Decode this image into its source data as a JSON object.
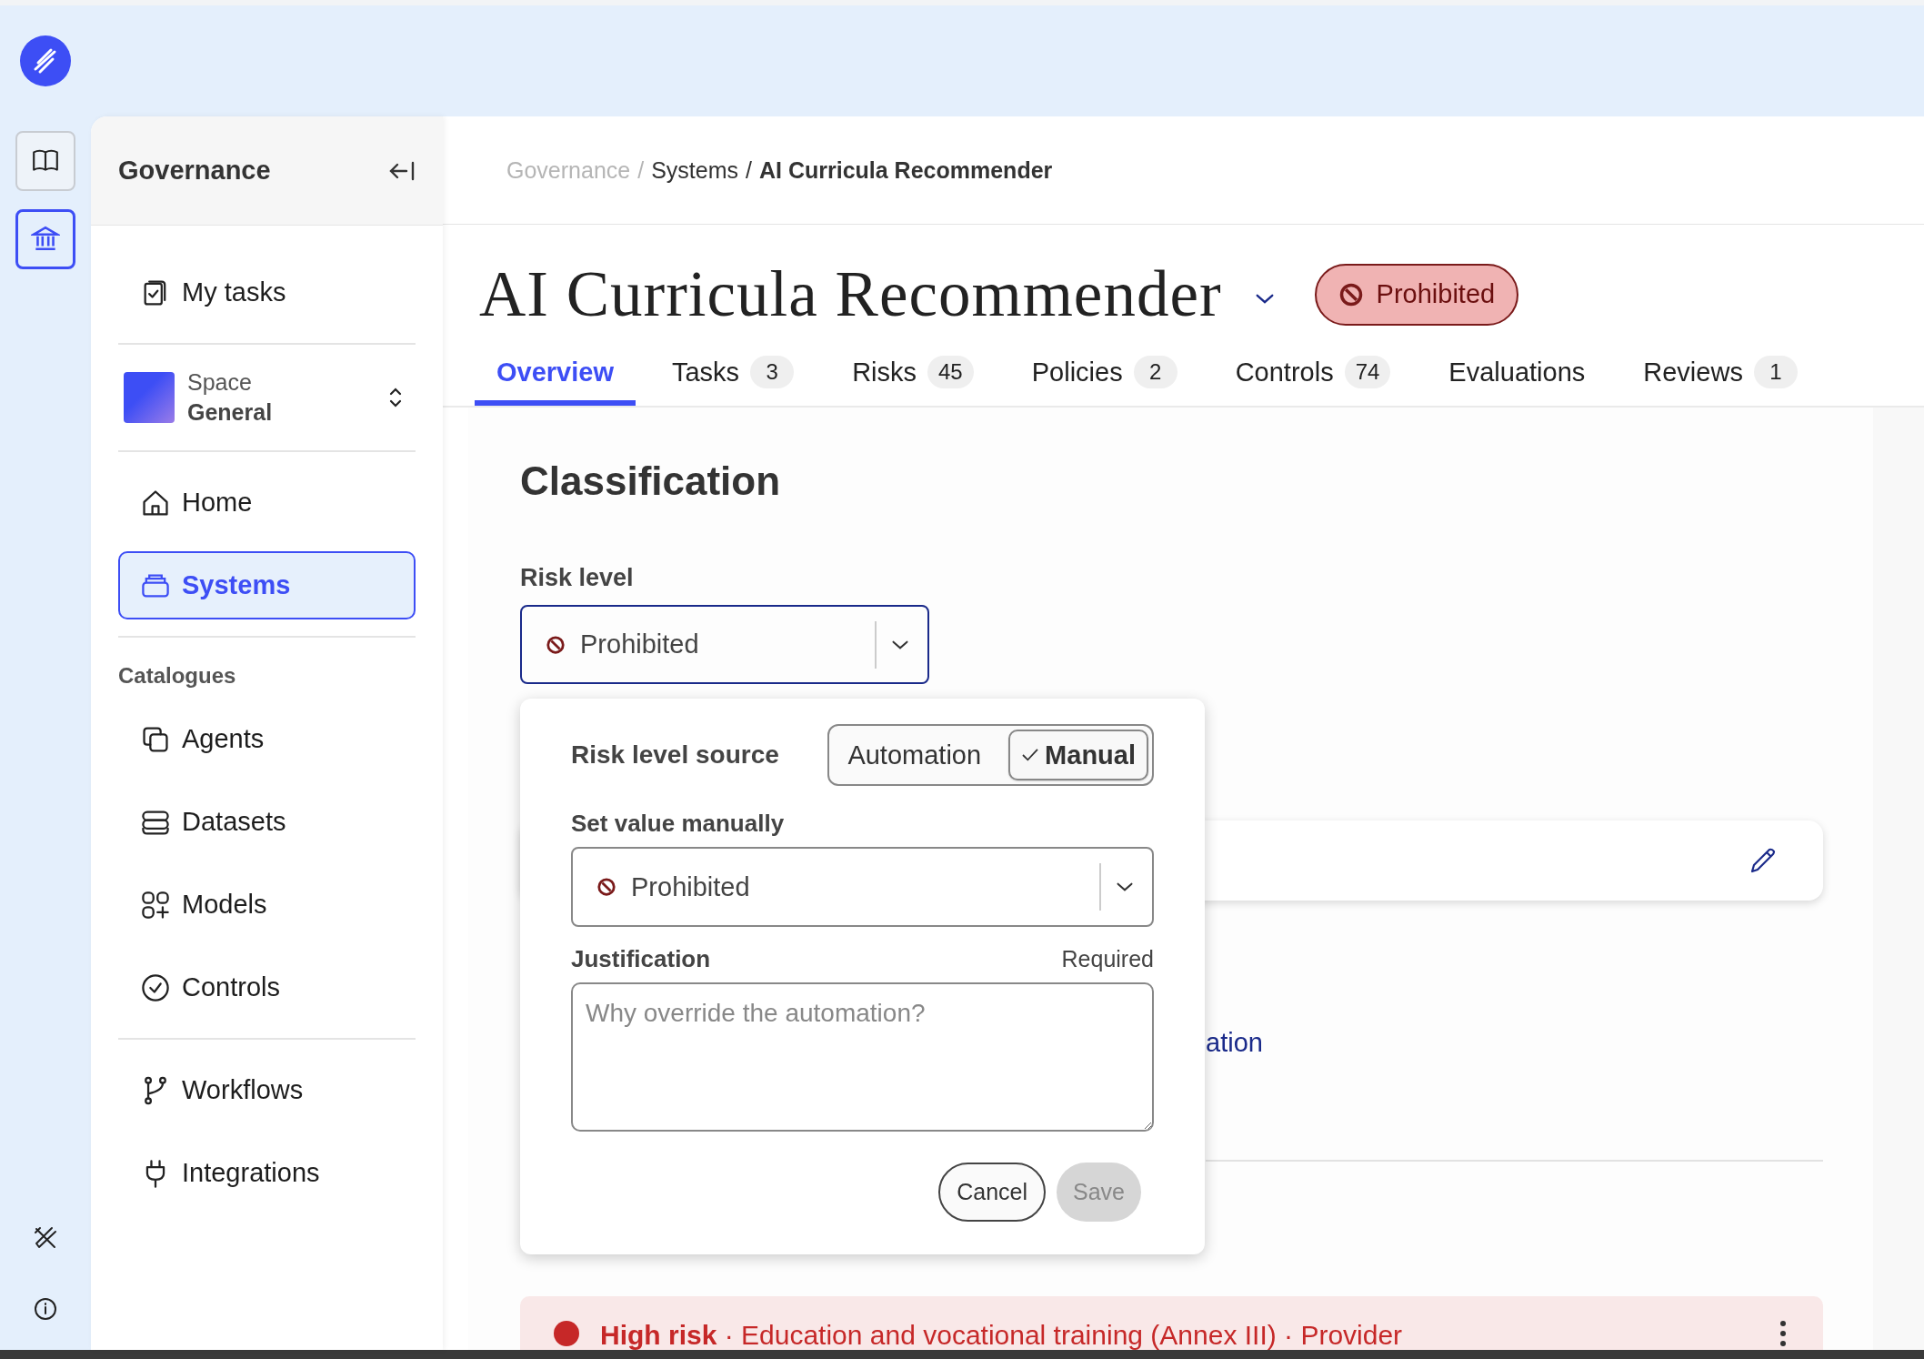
{
  "rail": {
    "items": [
      {
        "kind": "book",
        "selected": false
      },
      {
        "kind": "bank",
        "selected": true
      }
    ],
    "bottom_items": [
      {
        "kind": "tools"
      },
      {
        "kind": "info"
      }
    ]
  },
  "sidebar": {
    "title": "Governance",
    "groups": [
      {
        "items": [
          {
            "kind": "tasks",
            "label": "My tasks",
            "selected": false
          }
        ]
      },
      {
        "space": {
          "label": "Space",
          "value": "General"
        }
      },
      {
        "items": [
          {
            "kind": "home",
            "label": "Home",
            "selected": false
          },
          {
            "kind": "systems",
            "label": "Systems",
            "selected": true
          }
        ]
      },
      {
        "title": "Catalogues",
        "items": [
          {
            "kind": "agents",
            "label": "Agents",
            "selected": false
          },
          {
            "kind": "datasets",
            "label": "Datasets",
            "selected": false
          },
          {
            "kind": "models",
            "label": "Models",
            "selected": false
          },
          {
            "kind": "controls",
            "label": "Controls",
            "selected": false
          }
        ]
      },
      {
        "items": [
          {
            "kind": "workflows",
            "label": "Workflows",
            "selected": false
          },
          {
            "kind": "integrations",
            "label": "Integrations",
            "selected": false
          }
        ]
      }
    ]
  },
  "breadcrumb": {
    "separator": "/",
    "items": [
      "Governance",
      "Systems",
      "AI Curricula Recommender"
    ]
  },
  "title": "AI Curricula Recommender",
  "status_badge": {
    "label": "Prohibited"
  },
  "tabs": [
    {
      "label": "Overview",
      "selected": true
    },
    {
      "label": "Tasks",
      "count": "3",
      "selected": false
    },
    {
      "label": "Risks",
      "count": "45",
      "selected": false
    },
    {
      "label": "Policies",
      "count": "2",
      "selected": false
    },
    {
      "label": "Controls",
      "count": "74",
      "selected": false
    },
    {
      "label": "Evaluations",
      "selected": false
    },
    {
      "label": "Reviews",
      "count": "1",
      "selected": false
    }
  ],
  "classification": {
    "heading": "Classification",
    "risk_level": {
      "label": "Risk level",
      "value": "Prohibited"
    },
    "link": "ation",
    "banner": {
      "text": "**High risk** · Education and vocational training (Annex III) · Provider"
    }
  },
  "popup": {
    "source_label": "Risk level source",
    "options": [
      {
        "label": "Automation",
        "selected": false
      },
      {
        "label": "Manual",
        "selected": true
      }
    ],
    "manual_label": "Set value manually",
    "manual_value": "Prohibited",
    "justification_label": "Justification",
    "required": "Required",
    "placeholder": "Why override the automation?",
    "buttons": [
      {
        "label": "Cancel",
        "kind": "secondary",
        "disabled": false
      },
      {
        "label": "Save",
        "kind": "primary",
        "disabled": true
      }
    ]
  }
}
